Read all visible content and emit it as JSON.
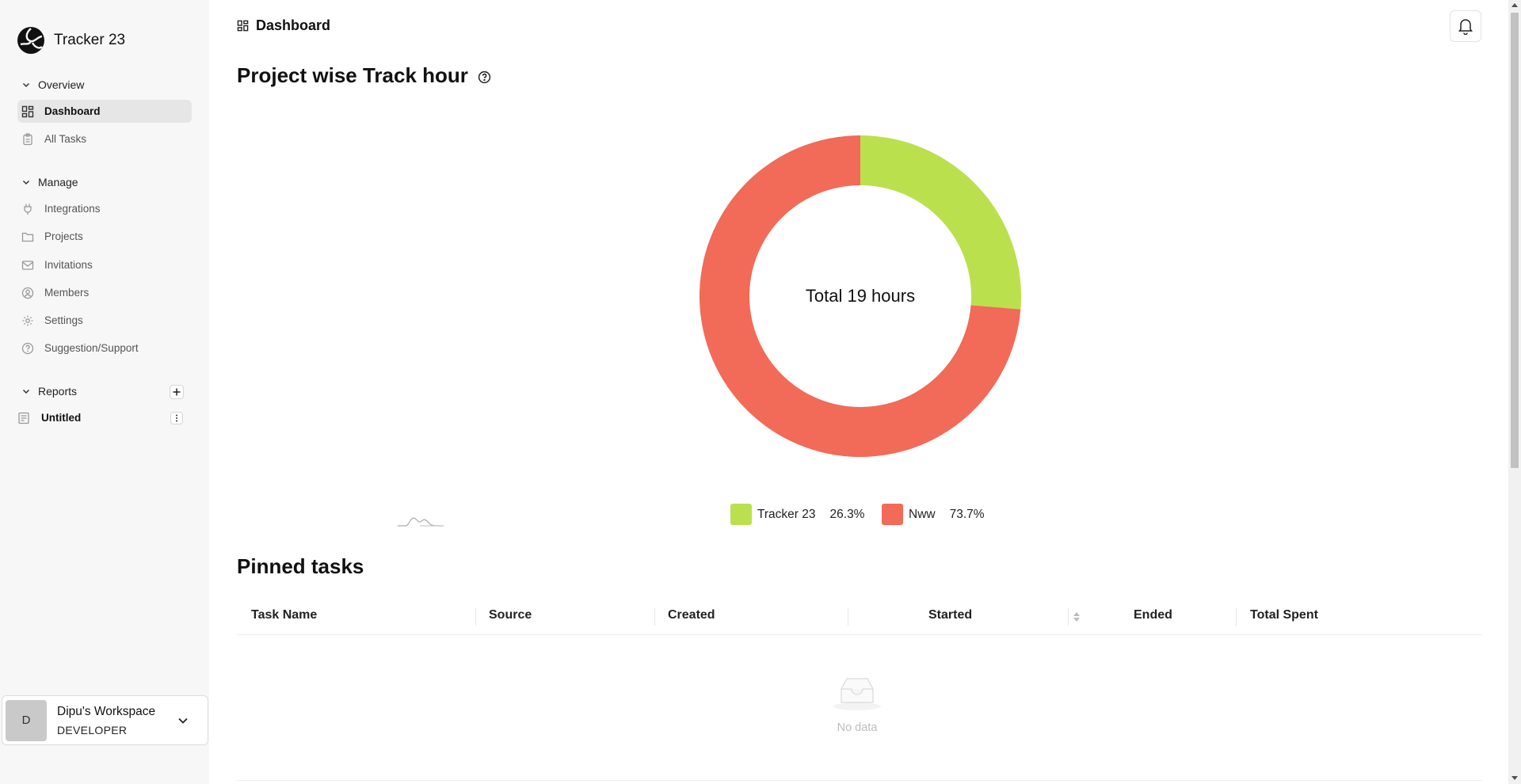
{
  "app": {
    "name": "Tracker 23"
  },
  "sidebar": {
    "overview": {
      "label": "Overview",
      "items": [
        {
          "label": "Dashboard",
          "icon": "dashboard-icon",
          "active": true
        },
        {
          "label": "All Tasks",
          "icon": "clipboard-icon",
          "active": false
        }
      ]
    },
    "manage": {
      "label": "Manage",
      "items": [
        {
          "label": "Integrations",
          "icon": "plug-icon"
        },
        {
          "label": "Projects",
          "icon": "folder-icon"
        },
        {
          "label": "Invitations",
          "icon": "mail-icon"
        },
        {
          "label": "Members",
          "icon": "user-circle-icon"
        },
        {
          "label": "Settings",
          "icon": "gear-icon"
        },
        {
          "label": "Suggestion/Support",
          "icon": "help-circle-icon"
        }
      ]
    },
    "reports": {
      "label": "Reports",
      "items": [
        {
          "label": "Untitled",
          "icon": "report-icon"
        }
      ]
    },
    "workspace": {
      "avatar": "D",
      "name": "Dipu's Workspace",
      "role": "DEVELOPER"
    }
  },
  "header": {
    "breadcrumb": "Dashboard"
  },
  "main": {
    "chart_title": "Project wise Track hour",
    "pinned_title": "Pinned tasks",
    "table": {
      "columns": [
        "Task Name",
        "Source",
        "Created",
        "Started",
        "Ended",
        "Total Spent"
      ],
      "rows": [],
      "empty_text": "No data"
    }
  },
  "colors": {
    "accent_green": "#bbe04e",
    "accent_red": "#f26a58"
  },
  "chart_data": {
    "type": "pie",
    "title": "Project wise Track hour",
    "center_label": "Total 19 hours",
    "slices": [
      {
        "name": "Tracker 23",
        "value": 26.3,
        "label": "26.3%",
        "color": "#bbe04e"
      },
      {
        "name": "Nww",
        "value": 73.7,
        "label": "73.7%",
        "color": "#f26a58"
      }
    ],
    "legend": "bottom"
  }
}
